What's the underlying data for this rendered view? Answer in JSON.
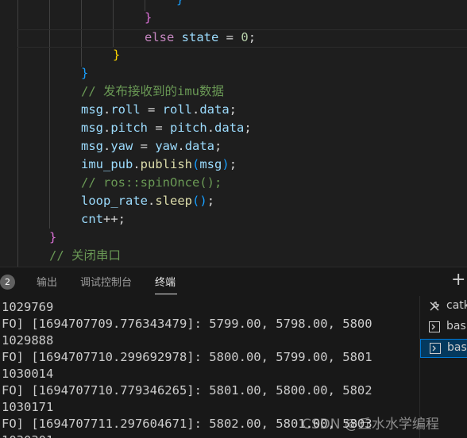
{
  "editor": {
    "lines": {
      "l1": "}",
      "l2": "}",
      "l3_kw": "else",
      "l3_var": "state",
      "l3_eq": " = ",
      "l3_num": "0",
      "l3_end": ";",
      "l4": "}",
      "l5": "}",
      "l6": "// 发布接收到的imu数据",
      "l7a": "msg",
      "l7b": ".",
      "l7c": "roll",
      "l7d": " = ",
      "l7e": "roll",
      "l7f": ".",
      "l7g": "data",
      "l7h": ";",
      "l8a": "msg",
      "l8b": ".",
      "l8c": "pitch",
      "l8d": " = ",
      "l8e": "pitch",
      "l8f": ".",
      "l8g": "data",
      "l8h": ";",
      "l9a": "msg",
      "l9b": ".",
      "l9c": "yaw",
      "l9d": " = ",
      "l9e": "yaw",
      "l9f": ".",
      "l9g": "data",
      "l9h": ";",
      "l10a": "imu_pub",
      "l10b": ".",
      "l10c": "publish",
      "l10d": "(",
      "l10e": "msg",
      "l10f": ")",
      "l10g": ";",
      "l11": "// ros::spinOnce();",
      "l12a": "loop_rate",
      "l12b": ".",
      "l12c": "sleep",
      "l12d": "()",
      "l12e": ";",
      "l13a": "cnt",
      "l13b": "++;",
      "l14": "}",
      "l15": "// 关闭串口"
    }
  },
  "panel": {
    "badge": "2",
    "tabs": [
      "输出",
      "调试控制台",
      "终端"
    ],
    "add_label": "+"
  },
  "terminal": {
    "lines": [
      "1029769",
      "FO] [1694707709.776343479]: 5799.00, 5798.00, 5800",
      "1029888",
      "FO] [1694707710.299692978]: 5800.00, 5799.00, 5801",
      "1030014",
      "FO] [1694707710.779346265]: 5801.00, 5800.00, 5802",
      "1030171",
      "FO] [1694707711.297604671]: 5802.00, 5801.00, 5803",
      "1030301"
    ],
    "list": [
      {
        "label": "catk",
        "icon": "tools-icon"
      },
      {
        "label": "bash",
        "icon": "terminal-icon"
      },
      {
        "label": "bash",
        "icon": "terminal-icon"
      }
    ]
  },
  "watermark": "CSDN @丘水水学编程",
  "colors": {
    "keyword": "#c586c0",
    "variable": "#9cdcfe",
    "function": "#dcdcaa",
    "number": "#b5cea8",
    "comment": "#6a9955",
    "bracket_gold": "#ffd700",
    "bracket_orchid": "#da70d6",
    "bracket_blue": "#179fff",
    "selection": "#04395e"
  }
}
